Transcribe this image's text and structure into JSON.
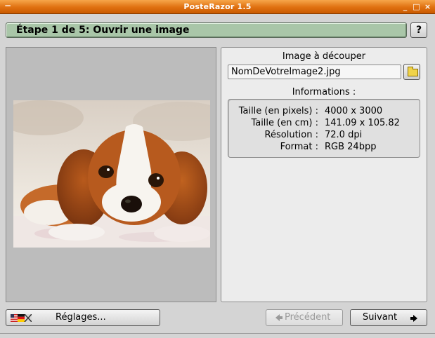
{
  "window": {
    "title": "PosteRazor 1.5",
    "menu_glyph": "−",
    "minimize_glyph": "_",
    "maximize_glyph": "□",
    "close_glyph": "×"
  },
  "step": {
    "title": "Étape 1 de 5: Ouvrir une image",
    "help_label": "?"
  },
  "image_section": {
    "label": "Image à découper",
    "file_name": "NomDeVotreImage2.jpg",
    "open_icon": "folder-icon"
  },
  "info": {
    "heading": "Informations :",
    "rows": [
      {
        "key": "Taille (en pixels) :",
        "value": "4000 x 3000"
      },
      {
        "key": "Taille (en cm) :",
        "value": "141.09 x 105.82"
      },
      {
        "key": "Résolution :",
        "value": "72.0 dpi"
      },
      {
        "key": "Format :",
        "value": "RGB 24bpp"
      }
    ]
  },
  "preview": {
    "subject": "puppy-photo"
  },
  "buttons": {
    "settings": "Réglages...",
    "previous": "Précédent",
    "next": "Suivant"
  },
  "colors": {
    "titlebar": "#e07010",
    "step_header": "#a9c6a8",
    "panel": "#ececec",
    "preview_bg": "#bcbcbc"
  }
}
